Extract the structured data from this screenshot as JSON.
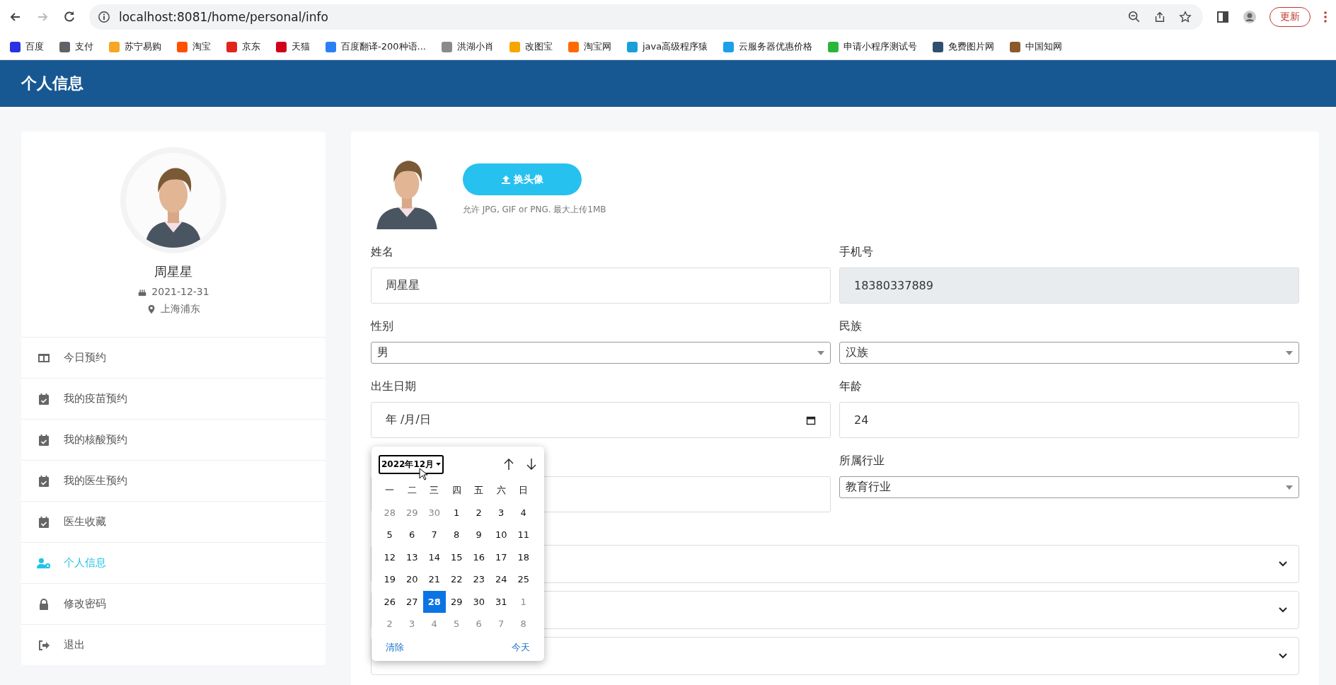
{
  "browser": {
    "url": "localhost:8081/home/personal/info",
    "update": "更新",
    "bookmarks": [
      {
        "label": "百度",
        "color": "#2932e1"
      },
      {
        "label": "支付",
        "color": "#5f6368"
      },
      {
        "label": "苏宁易购",
        "color": "#f5a623"
      },
      {
        "label": "淘宝",
        "color": "#ff5000"
      },
      {
        "label": "京东",
        "color": "#e1251b"
      },
      {
        "label": "天猫",
        "color": "#d0021b"
      },
      {
        "label": "百度翻译-200种语...",
        "color": "#2b7ff5"
      },
      {
        "label": "洪湖小肖",
        "color": "#8a8a8a"
      },
      {
        "label": "改图宝",
        "color": "#f7a600"
      },
      {
        "label": "淘宝网",
        "color": "#ff6a00"
      },
      {
        "label": "java高级程序猿",
        "color": "#1a9fd9"
      },
      {
        "label": "云服务器优惠价格",
        "color": "#1aa1e8"
      },
      {
        "label": "申请小程序测试号",
        "color": "#2ab53b"
      },
      {
        "label": "免费图片网",
        "color": "#2f4f6f"
      },
      {
        "label": "中国知网",
        "color": "#8b5a2b"
      }
    ]
  },
  "header": {
    "title": "个人信息"
  },
  "profile": {
    "name": "周星星",
    "birthday": "2021-12-31",
    "location": "上海浦东"
  },
  "sidebar": {
    "items": [
      {
        "label": "今日预约",
        "kind": "columns",
        "selected": false
      },
      {
        "label": "我的疫苗预约",
        "kind": "calendar",
        "selected": false
      },
      {
        "label": "我的核酸预约",
        "kind": "calendar",
        "selected": false
      },
      {
        "label": "我的医生预约",
        "kind": "calendar",
        "selected": false
      },
      {
        "label": "医生收藏",
        "kind": "calendar",
        "selected": false
      },
      {
        "label": "个人信息",
        "kind": "user",
        "selected": true
      },
      {
        "label": "修改密码",
        "kind": "lock",
        "selected": false
      },
      {
        "label": "退出",
        "kind": "exit",
        "selected": false
      }
    ]
  },
  "avatar": {
    "button": "换头像",
    "hint": "允许 JPG, GIF or PNG. 最大上传1MB"
  },
  "form": {
    "rows": [
      {
        "fields": [
          {
            "kind": "text",
            "label": "姓名",
            "value": "周星星",
            "disabled": false
          },
          {
            "kind": "text",
            "label": "手机号",
            "value": "18380337889",
            "disabled": true
          }
        ]
      },
      {
        "fields": [
          {
            "kind": "select",
            "label": "性别",
            "value": "男",
            "disabled": false
          },
          {
            "kind": "select",
            "label": "民族",
            "value": "汉族",
            "disabled": false
          }
        ]
      },
      {
        "fields": [
          {
            "kind": "date",
            "label": "出生日期",
            "placeholder": "年 /月/日",
            "disabled": false
          },
          {
            "kind": "text",
            "label": "年龄",
            "value": "24",
            "disabled": false
          }
        ]
      },
      {
        "fields": [
          {
            "kind": "text",
            "disabled": false
          },
          {
            "kind": "select",
            "label": "所属行业",
            "value": "教育行业",
            "disabled": false
          }
        ]
      }
    ],
    "wide": [
      {
        "kind": "dropdown",
        "disabled": false
      },
      {
        "kind": "dropdown",
        "disabled": false
      },
      {
        "kind": "dropdown",
        "disabled": false
      }
    ]
  },
  "calendar": {
    "month": "2022年12月",
    "weekdays": [
      "一",
      "二",
      "三",
      "四",
      "五",
      "六",
      "日"
    ],
    "days": [
      {
        "label": "28",
        "muted": true,
        "selected": false
      },
      {
        "label": "29",
        "muted": true,
        "selected": false
      },
      {
        "label": "30",
        "muted": true,
        "selected": false
      },
      {
        "label": "1",
        "muted": false,
        "selected": false
      },
      {
        "label": "2",
        "muted": false,
        "selected": false
      },
      {
        "label": "3",
        "muted": false,
        "selected": false
      },
      {
        "label": "4",
        "muted": false,
        "selected": false
      },
      {
        "label": "5",
        "muted": false,
        "selected": false
      },
      {
        "label": "6",
        "muted": false,
        "selected": false
      },
      {
        "label": "7",
        "muted": false,
        "selected": false
      },
      {
        "label": "8",
        "muted": false,
        "selected": false
      },
      {
        "label": "9",
        "muted": false,
        "selected": false
      },
      {
        "label": "10",
        "muted": false,
        "selected": false
      },
      {
        "label": "11",
        "muted": false,
        "selected": false
      },
      {
        "label": "12",
        "muted": false,
        "selected": false
      },
      {
        "label": "13",
        "muted": false,
        "selected": false
      },
      {
        "label": "14",
        "muted": false,
        "selected": false
      },
      {
        "label": "15",
        "muted": false,
        "selected": false
      },
      {
        "label": "16",
        "muted": false,
        "selected": false
      },
      {
        "label": "17",
        "muted": false,
        "selected": false
      },
      {
        "label": "18",
        "muted": false,
        "selected": false
      },
      {
        "label": "19",
        "muted": false,
        "selected": false
      },
      {
        "label": "20",
        "muted": false,
        "selected": false
      },
      {
        "label": "21",
        "muted": false,
        "selected": false
      },
      {
        "label": "22",
        "muted": false,
        "selected": false
      },
      {
        "label": "23",
        "muted": false,
        "selected": false
      },
      {
        "label": "24",
        "muted": false,
        "selected": false
      },
      {
        "label": "25",
        "muted": false,
        "selected": false
      },
      {
        "label": "26",
        "muted": false,
        "selected": false
      },
      {
        "label": "27",
        "muted": false,
        "selected": false
      },
      {
        "label": "28",
        "muted": false,
        "selected": true
      },
      {
        "label": "29",
        "muted": false,
        "selected": false
      },
      {
        "label": "30",
        "muted": false,
        "selected": false
      },
      {
        "label": "31",
        "muted": false,
        "selected": false
      },
      {
        "label": "1",
        "muted": true,
        "selected": false
      },
      {
        "label": "2",
        "muted": true,
        "selected": false
      },
      {
        "label": "3",
        "muted": true,
        "selected": false
      },
      {
        "label": "4",
        "muted": true,
        "selected": false
      },
      {
        "label": "5",
        "muted": true,
        "selected": false
      },
      {
        "label": "6",
        "muted": true,
        "selected": false
      },
      {
        "label": "7",
        "muted": true,
        "selected": false
      },
      {
        "label": "8",
        "muted": true,
        "selected": false
      }
    ],
    "clear": "清除",
    "today": "今天"
  }
}
